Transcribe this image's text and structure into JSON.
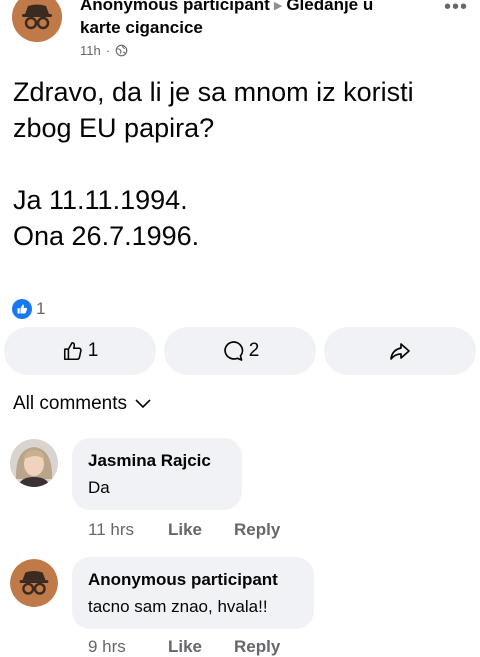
{
  "post": {
    "author": "Anonymous participant",
    "group": "Gledanje u karte cigancice",
    "time": "11h",
    "audience_icon": "globe-icon",
    "body": "Zdravo, da li je sa mnom iz koristi\nzbog EU papira?\n\nJa 11.11.1994.\nOna 26.7.1996.",
    "reaction_count": "1"
  },
  "actions": {
    "like_count": "1",
    "comment_count": "2",
    "like_icon": "thumbs-up-icon",
    "comment_icon": "comment-icon",
    "share_icon": "share-icon"
  },
  "comments_filter": "All comments",
  "comments": [
    {
      "name": "Jasmina Rajcic",
      "text": "Da",
      "time": "11 hrs",
      "like_label": "Like",
      "reply_label": "Reply"
    },
    {
      "name": "Anonymous participant",
      "text": "tacno sam znao, hvala!!",
      "time": "9 hrs",
      "like_label": "Like",
      "reply_label": "Reply"
    }
  ],
  "colors": {
    "accent": "#1877f2",
    "bubble": "#f0f2f5",
    "secondary_text": "#65676b",
    "anon_avatar": "#c07a4a"
  }
}
